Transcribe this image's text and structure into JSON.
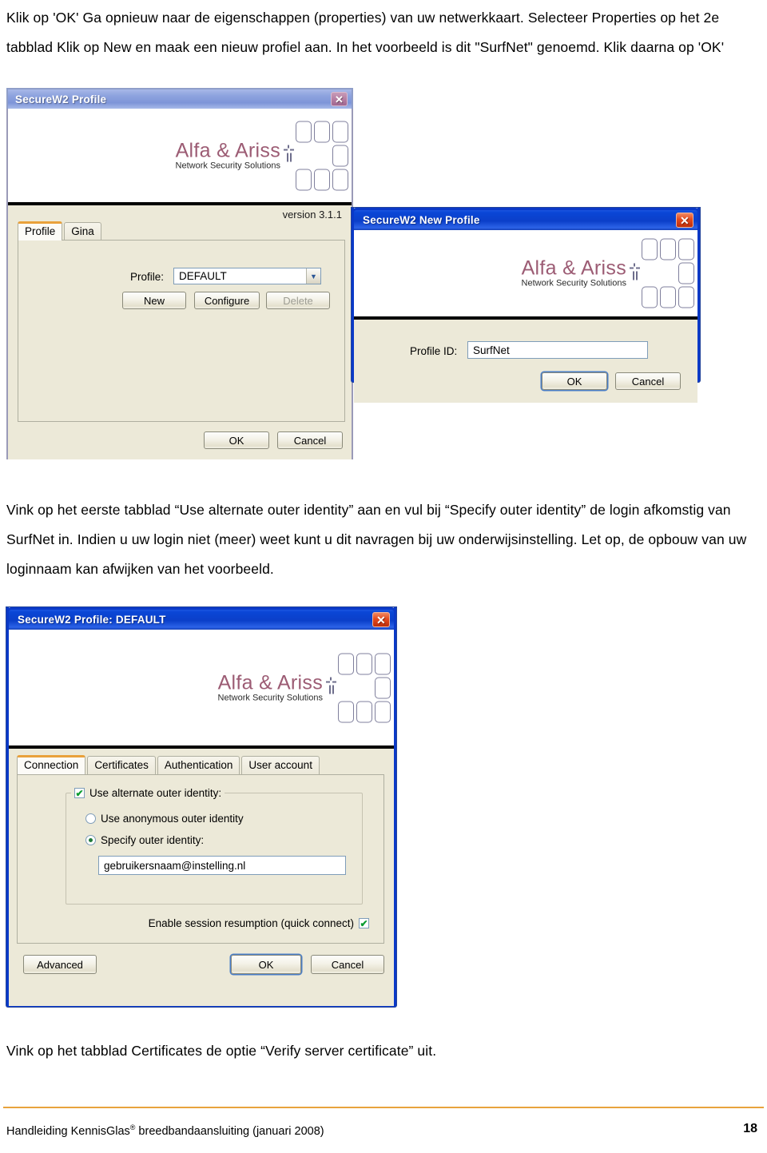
{
  "page": {
    "paragraph_top": "Klik op 'OK' Ga opnieuw naar de eigenschappen (properties) van uw netwerkkaart. Selecteer Properties op het 2e tabblad Klik op New en maak een nieuw profiel aan. In het voorbeeld is dit \"SurfNet\" genoemd. Klik daarna op 'OK'",
    "paragraph_middle": "Vink op het eerste tabblad “Use alternate outer identity” aan en vul bij “Specify outer identity” de login afkomstig van SurfNet in. Indien u uw login niet (meer) weet kunt u dit navragen bij uw onderwijsinstelling. Let op, de opbouw van uw loginnaam kan afwijken van het voorbeeld.",
    "paragraph_bottom": "Vink op het tabblad Certificates de optie “Verify server certificate” uit."
  },
  "footer": {
    "text_before": "Handleiding KennisGlas",
    "registered_mark": "®",
    "text_after": " breedbandaansluiting  (januari 2008)",
    "page_number": "18",
    "rule_color": "#E8A33D"
  },
  "logo": {
    "title": "Alfa & Ariss",
    "subtitle": "Network Security Solutions",
    "title_color": "#9C5C74"
  },
  "profile_window": {
    "title": "SecureW2 Profile",
    "close_glyph": "✕",
    "state": "inactive",
    "version_label": "version 3.1.1",
    "tabs": [
      {
        "label": "Profile",
        "selected": true
      },
      {
        "label": "Gina",
        "selected": false
      }
    ],
    "profile_field_label": "Profile:",
    "profile_value": "DEFAULT",
    "dropdown_glyph": "▼",
    "buttons": [
      {
        "label": "New",
        "disabled": false
      },
      {
        "label": "Configure",
        "disabled": false
      },
      {
        "label": "Delete",
        "disabled": true
      }
    ],
    "ok_label": "OK",
    "cancel_label": "Cancel"
  },
  "new_profile_window": {
    "title": "SecureW2 New Profile",
    "close_glyph": "✕",
    "state": "active",
    "profile_id_label": "Profile ID:",
    "profile_id_value": "SurfNet",
    "ok_label": "OK",
    "cancel_label": "Cancel"
  },
  "profile_default_window": {
    "title": "SecureW2 Profile: DEFAULT",
    "close_glyph": "✕",
    "state": "active",
    "tabs": [
      {
        "label": "Connection",
        "selected": true
      },
      {
        "label": "Certificates",
        "selected": false
      },
      {
        "label": "Authentication",
        "selected": false
      },
      {
        "label": "User account",
        "selected": false
      }
    ],
    "use_alternate_label": "Use alternate outer identity:",
    "use_alternate_checked": true,
    "check_glyph": "✔",
    "radio_anonymous_label": "Use anonymous outer identity",
    "radio_anonymous_selected": false,
    "radio_specify_label": "Specify outer identity:",
    "radio_specify_selected": true,
    "outer_identity_value": "gebruikersnaam@instelling.nl",
    "session_resumption_label": "Enable session resumption (quick connect)",
    "session_resumption_checked": true,
    "advanced_label": "Advanced",
    "ok_label": "OK",
    "cancel_label": "Cancel"
  }
}
